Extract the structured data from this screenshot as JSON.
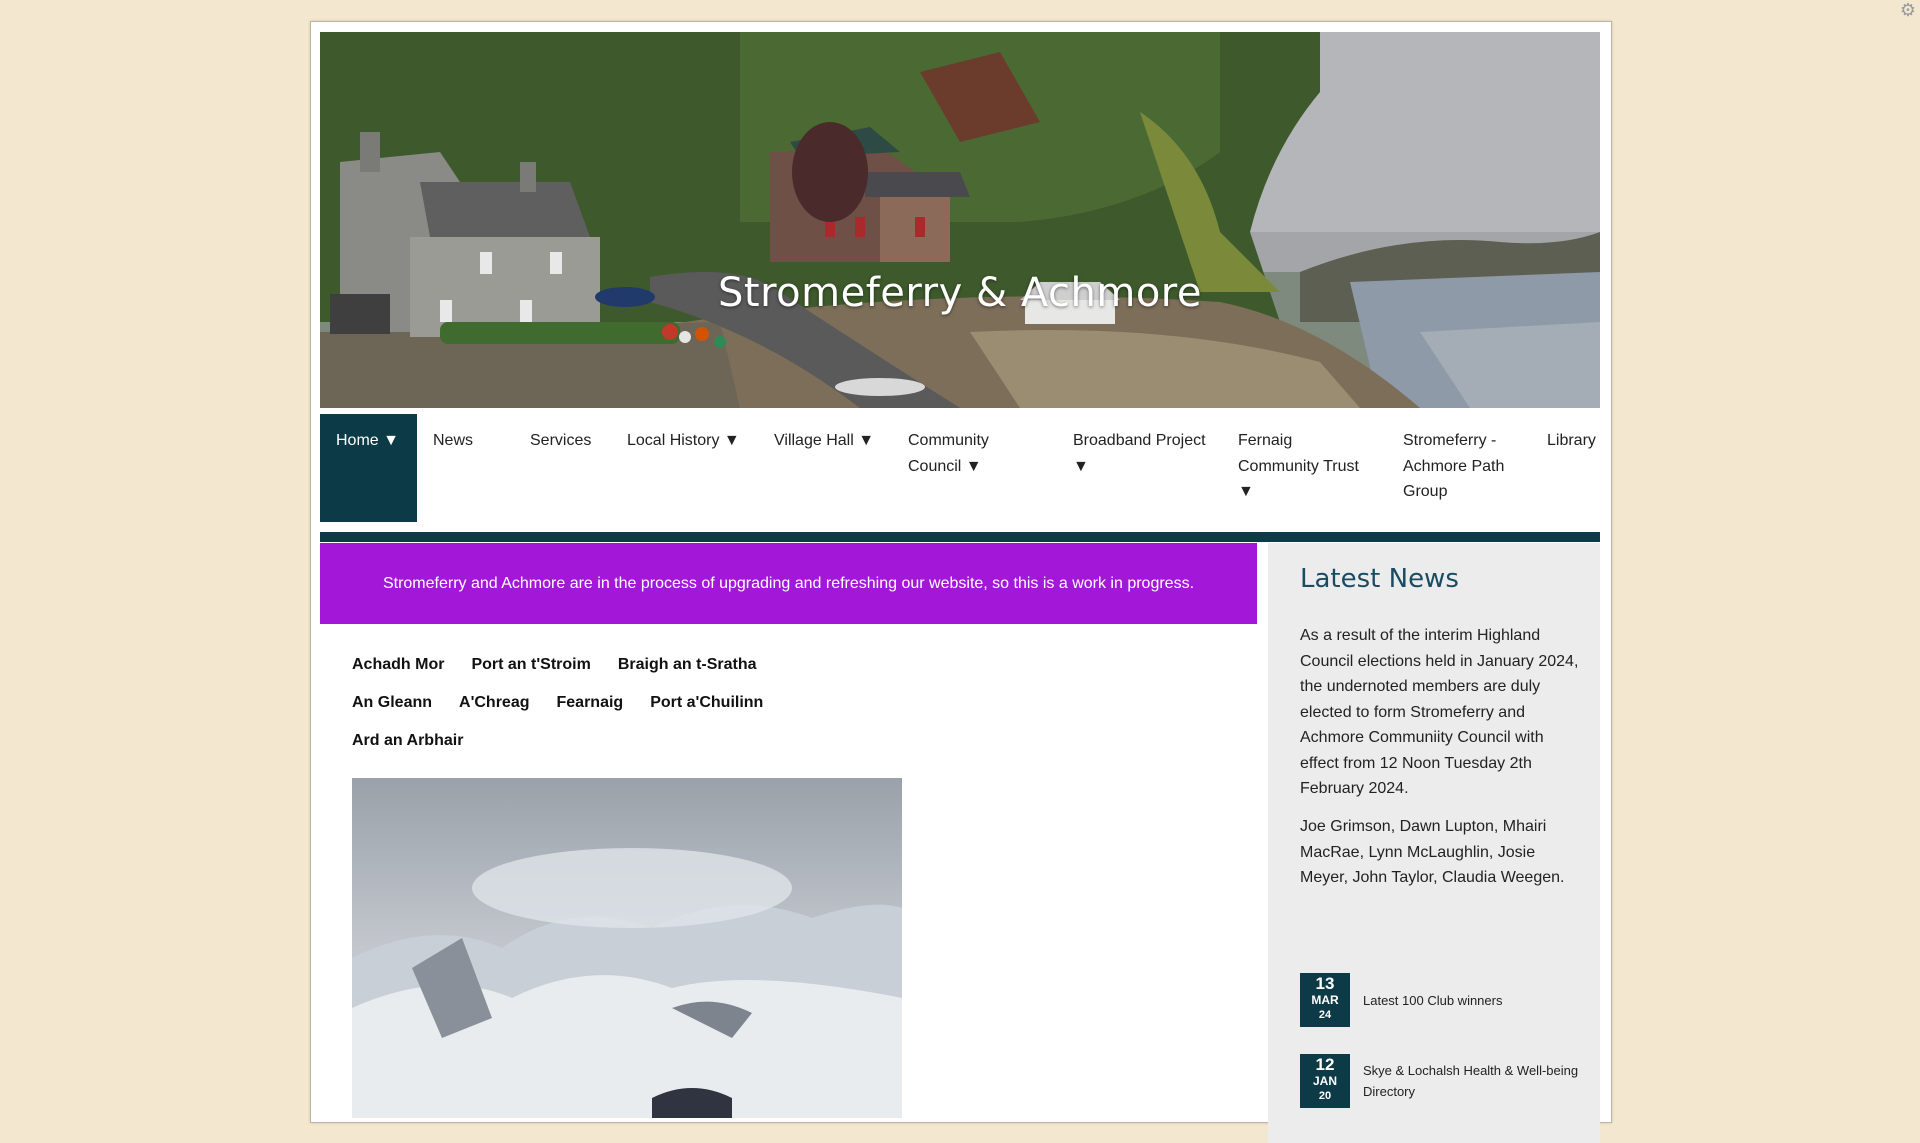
{
  "site": {
    "title": "Stromeferry & Achmore",
    "corner_icon": "settings-icon"
  },
  "nav": {
    "items": [
      {
        "label": "Home ▼"
      },
      {
        "label": "News"
      },
      {
        "label": "Services"
      },
      {
        "label": "Local History ▼"
      },
      {
        "label": "Village Hall ▼"
      },
      {
        "label": "Community Council ▼"
      },
      {
        "label": "Broadband Project ▼"
      },
      {
        "label": "Fernaig Community Trust ▼"
      },
      {
        "label": "Stromeferry - Achmore Path Group"
      },
      {
        "label": "Library"
      }
    ]
  },
  "banner": {
    "text": "Stromeferry and Achmore are in the process of upgrading and refreshing our website, so this is a work in progress."
  },
  "places": {
    "row1": [
      "Achadh Mor",
      "Port an t'Stroim",
      "Braigh an t-Sratha"
    ],
    "row2": [
      "An Gleann",
      "A'Chreag",
      "Fearnaig",
      "Port a'Chuilinn"
    ],
    "row3": [
      "Ard an Arbhair"
    ]
  },
  "sidebar": {
    "heading": "Latest News",
    "para1": "As a result of the interim Highland Council elections held in January 2024, the undernoted members are duly elected to form Stromeferry and Achmore Communiity Council with effect from 12 Noon Tuesday 2th February 2024.",
    "para2": "Joe Grimson, Dawn Lupton, Mhairi MacRae, Lynn McLaughlin, Josie Meyer, John Taylor, Claudia Weegen.",
    "news": [
      {
        "day": "13",
        "month": "MAR",
        "year": "24",
        "title": "Latest 100 Club winners"
      },
      {
        "day": "12",
        "month": "JAN",
        "year": "20",
        "title": "Skye & Lochalsh Health & Well-being Directory"
      }
    ]
  },
  "colors": {
    "background": "#f3e8cf",
    "nav_active": "#0c3a47",
    "banner": "#a318d8",
    "sidebar_heading": "#1b4b62"
  }
}
